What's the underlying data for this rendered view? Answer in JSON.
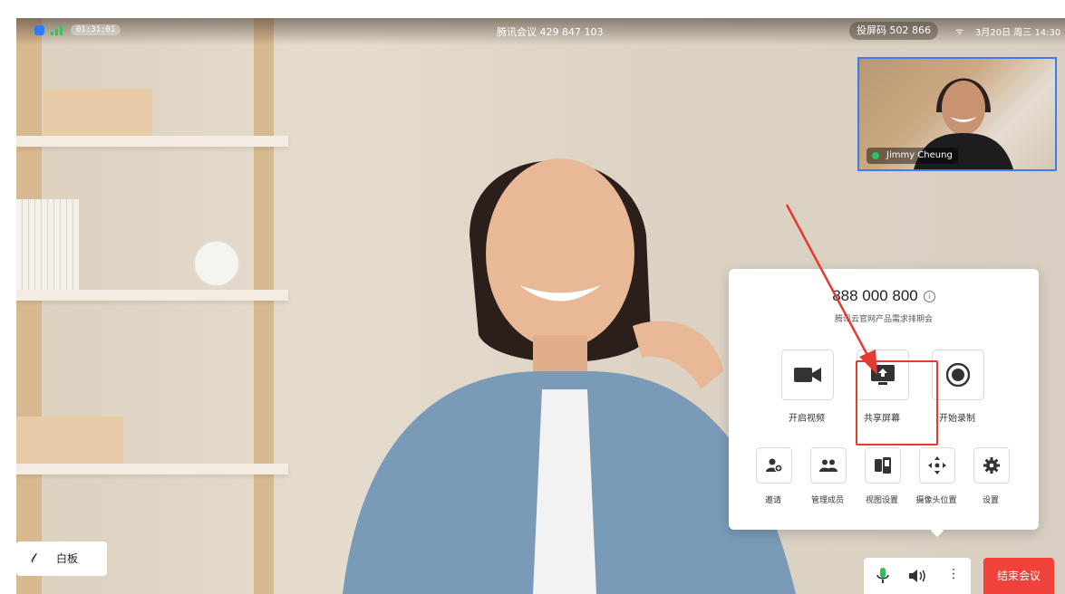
{
  "status_bar": {
    "timer": "01:31:01",
    "meeting_title": "腾讯会议 429 847 103",
    "cast_code": "投屏码 502 866",
    "date_time": "3月20日 周三 14:30",
    "icons": [
      "shield-icon",
      "signal-icon",
      "wifi-icon"
    ]
  },
  "self_view": {
    "name": "Jimmy Cheung",
    "icon": "mic-icon",
    "border_color": "#3d7bf0"
  },
  "control_panel": {
    "meeting_number": "888 000 800",
    "meeting_name": "腾讯云官网产品需求排期会",
    "primary_actions": [
      {
        "label": "开启视频",
        "icon": "video-camera-icon"
      },
      {
        "label": "共享屏幕",
        "icon": "share-screen-icon"
      },
      {
        "label": "开始录制",
        "icon": "record-icon"
      }
    ],
    "secondary_actions": [
      {
        "label": "邀请",
        "icon": "invite-icon"
      },
      {
        "label": "管理成员",
        "icon": "members-icon"
      },
      {
        "label": "视图设置",
        "icon": "view-settings-icon"
      },
      {
        "label": "摄像头位置",
        "icon": "camera-position-icon"
      },
      {
        "label": "设置",
        "icon": "gear-icon"
      }
    ],
    "highlight_color": "#e43a30"
  },
  "bottom_bar": {
    "whiteboard_label": "白板",
    "end_meeting_label": "结束会议",
    "end_color": "#f0413b"
  }
}
